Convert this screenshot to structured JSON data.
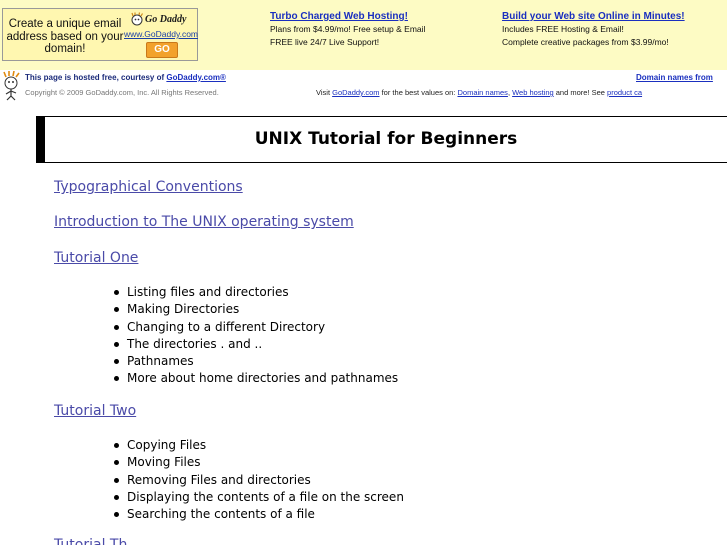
{
  "ad_banner": {
    "box_text": "Create a unique email address based on your domain!",
    "logo_word": "Go Daddy",
    "logo_url": "www.GoDaddy.com",
    "go_button": "GO",
    "promo1": {
      "title": "Turbo Charged Web Hosting!",
      "line1": "Plans from $4.99/mo! Free setup & Email",
      "line2": "FREE live 24/7 Live Support!"
    },
    "promo2": {
      "title": "Build your Web site Online in Minutes!",
      "line1": "Includes FREE Hosting & Email!",
      "line2": "Complete creative packages from $3.99/mo!"
    }
  },
  "host_bar": {
    "hosted_prefix": "This page is hosted free, courtesy of ",
    "hosted_link": "GoDaddy.com®",
    "copyright": "Copyright © 2009 GoDaddy.com, Inc. All Rights Reserved.",
    "domain_names_from": "Domain names from",
    "visit_prefix": "Visit ",
    "visit_link": "GoDaddy.com",
    "visit_mid": " for the best values on: ",
    "domain_names_link": "Domain names",
    "comma": ", ",
    "web_hosting_link": "Web hosting",
    "and_more": " and more! See ",
    "product_link": "product ca"
  },
  "page_title": "UNIX Tutorial for Beginners",
  "sections": {
    "typographical": "Typographical Conventions",
    "introduction": "Introduction to The UNIX operating system",
    "tutorial_one": "Tutorial One",
    "tutorial_two": "Tutorial Two",
    "tutorial_three_partial": "Tutorial Th"
  },
  "tutorial_one_items": [
    "Listing files and directories",
    "Making Directories",
    "Changing to a different Directory",
    "The directories . and ..",
    "Pathnames",
    "More about home directories and pathnames"
  ],
  "tutorial_two_items": [
    "Copying Files",
    "Moving Files",
    "Removing Files and directories",
    "Displaying the contents of a file on the screen",
    "Searching the contents of a file"
  ]
}
